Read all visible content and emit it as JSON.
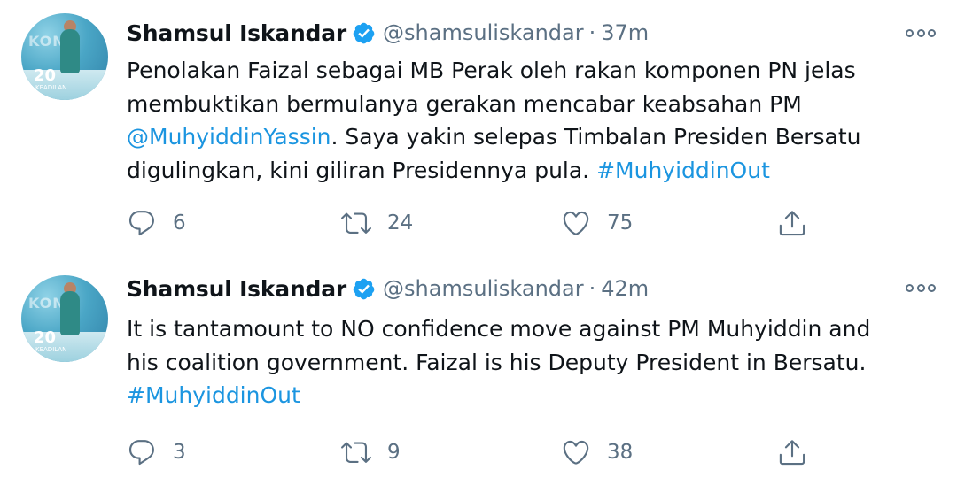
{
  "colors": {
    "text": "#0f1419",
    "secondary": "#5b7083",
    "link": "#1b95e0",
    "verified": "#1da1f2",
    "divider": "#e6ecf0"
  },
  "tweets": [
    {
      "author": {
        "name": "Shamsul Iskandar",
        "handle": "@shamsuliskandar",
        "verified": true
      },
      "time": "37m",
      "text_lines": [
        [
          {
            "t": "Penolakan Faizal sebagai MB Perak oleh rakan komponen PN jelas"
          }
        ],
        [
          {
            "t": "membuktikan bermulanya gerakan mencabar keabsahan PM"
          }
        ],
        [
          {
            "t": "@MuhyiddinYassin",
            "link": true
          },
          {
            "t": ". Saya yakin selepas Timbalan Presiden Bersatu"
          }
        ],
        [
          {
            "t": "digulingkan, kini giliran Presidennya pula. "
          },
          {
            "t": "#MuhyiddinOut",
            "link": true
          }
        ]
      ],
      "stats": {
        "replies": "6",
        "retweets": "24",
        "likes": "75"
      }
    },
    {
      "author": {
        "name": "Shamsul Iskandar",
        "handle": "@shamsuliskandar",
        "verified": true
      },
      "time": "42m",
      "text_lines": [
        [
          {
            "t": "It is tantamount to NO confidence move against PM Muhyiddin and"
          }
        ],
        [
          {
            "t": "his coalition government. Faizal is his Deputy President in Bersatu."
          }
        ],
        [
          {
            "t": "#MuhyiddinOut",
            "link": true
          }
        ]
      ],
      "stats": {
        "replies": "3",
        "retweets": "9",
        "likes": "38"
      }
    }
  ],
  "icons": {
    "reply": "reply-icon",
    "retweet": "retweet-icon",
    "like": "heart-icon",
    "share": "share-icon",
    "more": "more-options-icon",
    "verified": "verified-badge-icon"
  }
}
